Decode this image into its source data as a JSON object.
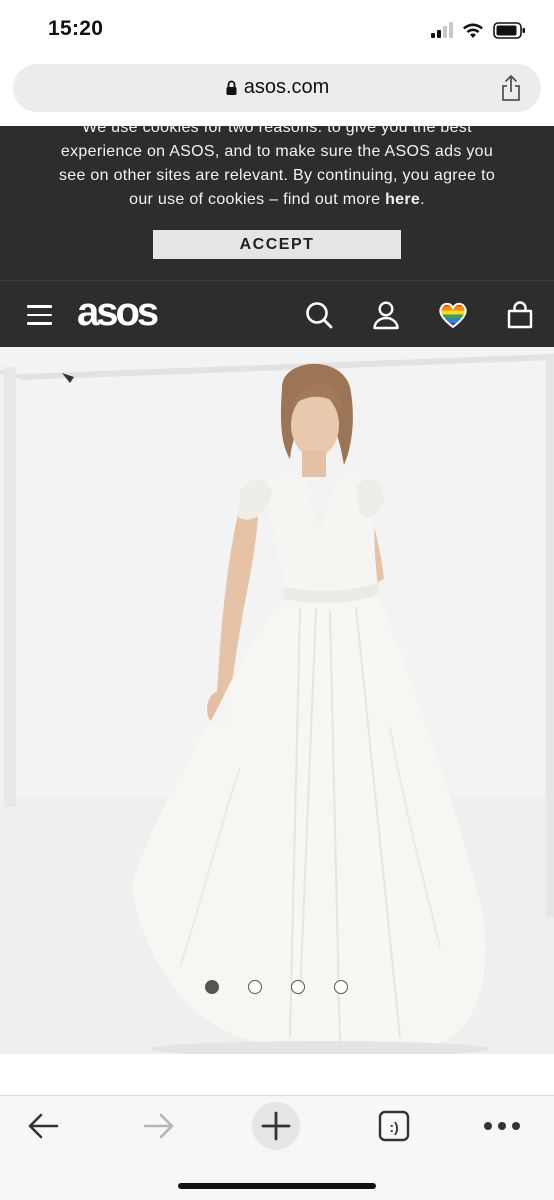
{
  "status_bar": {
    "time": "15:20",
    "icons": [
      "signal-icon",
      "wifi-icon",
      "battery-icon"
    ]
  },
  "browser": {
    "url": "asos.com",
    "lock_icon": "lock-icon",
    "share_icon": "share-icon"
  },
  "cookie_banner": {
    "line_top": "We use cookies for two reasons: to give you the best",
    "line_1": "experience on ASOS, and to make sure the ASOS ads you",
    "line_2": "see on other sites are relevant. By continuing, you agree to",
    "line_3_prefix": "our use of cookies – find out more ",
    "line_3_link": "here",
    "line_3_suffix": ".",
    "accept_label": "ACCEPT"
  },
  "header": {
    "logo": "asos",
    "icons": [
      "menu-icon",
      "search-icon",
      "account-icon",
      "saved-items-heart-icon",
      "bag-icon"
    ]
  },
  "gallery": {
    "image_count": 4,
    "active_index": 0
  },
  "toolbar": {
    "icons": [
      "back-icon",
      "forward-icon",
      "new-tab-icon",
      "tabs-icon",
      "more-icon"
    ],
    "tabs_label": ":)"
  },
  "colors": {
    "header_bg": "#2d2d2d",
    "accept_bg": "#e5e5e5",
    "page_bg": "#ffffff",
    "toolbar_bg": "#f7f7f7"
  }
}
